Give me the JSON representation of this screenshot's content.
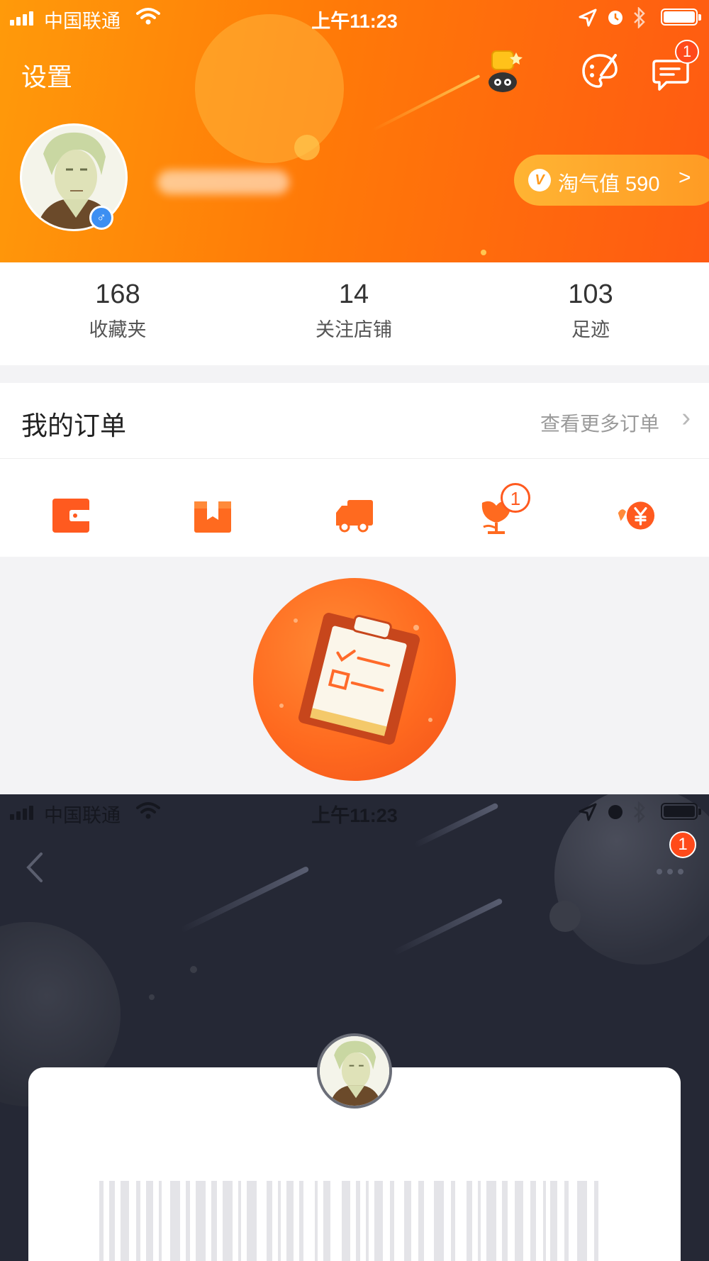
{
  "top_screen": {
    "status_bar": {
      "carrier": "中国联通",
      "time": "上午11:23"
    },
    "header": {
      "settings_label": "设置",
      "message_badge": "1"
    },
    "profile": {
      "taoqi_label": "淘气值 590",
      "taoqi_arrow": ">"
    },
    "stats": [
      {
        "value": "168",
        "label": "收藏夹"
      },
      {
        "value": "14",
        "label": "关注店铺"
      },
      {
        "value": "103",
        "label": "足迹"
      }
    ],
    "orders": {
      "title": "我的订单",
      "more_label": "查看更多订单",
      "icons": [
        "wallet-icon",
        "package-icon",
        "truck-icon",
        "review-icon",
        "refund-icon"
      ],
      "review_badge": "1"
    }
  },
  "bottom_screen": {
    "status_bar": {
      "carrier": "中国联通",
      "time": "上午11:23"
    },
    "notification_badge": "1"
  },
  "colors": {
    "brand_orange": "#ff7a08",
    "badge_red": "#ff4a1a",
    "dark_bg": "#252835"
  }
}
